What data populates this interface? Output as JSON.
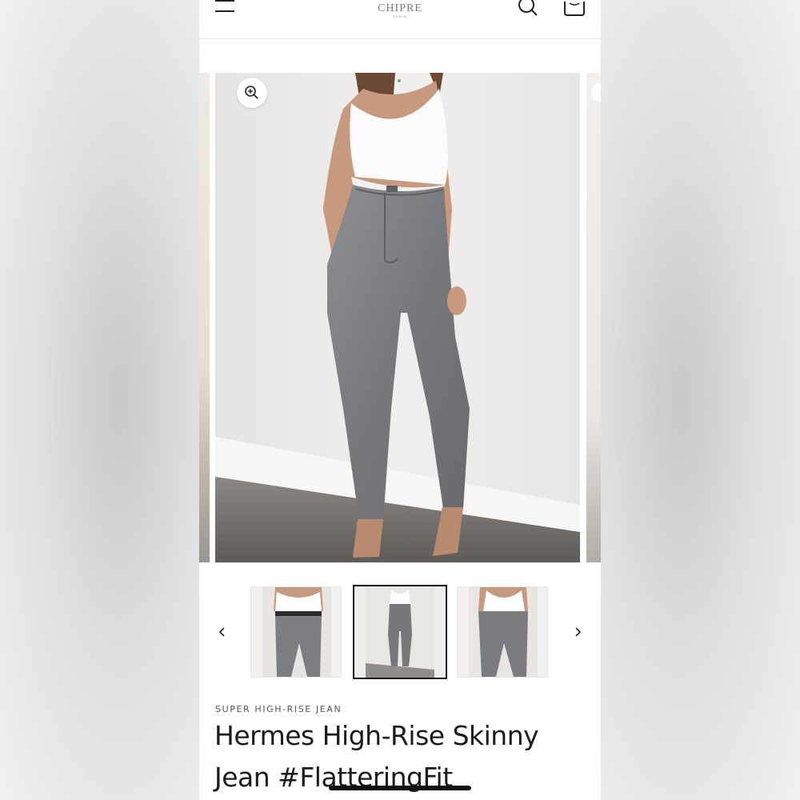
{
  "header": {
    "logo_text": "CHIPRE",
    "logo_sub": "DENIM",
    "icons": {
      "menu": "hamburger-menu-icon",
      "search": "search-icon",
      "cart": "shopping-bag-icon"
    }
  },
  "gallery": {
    "zoom_icon": "zoom-in-icon",
    "main_image_alt": "main-product-photo",
    "thumbnails": [
      {
        "label": "thumbnail-back-view",
        "selected": false
      },
      {
        "label": "thumbnail-full-front-view",
        "selected": true
      },
      {
        "label": "thumbnail-back-close-view",
        "selected": false
      }
    ],
    "prev_icon": "chevron-left-icon",
    "next_icon": "chevron-right-icon"
  },
  "product": {
    "eyebrow": "SUPER HIGH-RISE JEAN",
    "title_line1": "Hermes High-Rise Skinny",
    "title_line2": "Jean #FlatteringFit"
  },
  "colors": {
    "accent": "#111111",
    "text": "#1b1b1b",
    "muted": "#555555",
    "denim": "#7d7f82"
  }
}
